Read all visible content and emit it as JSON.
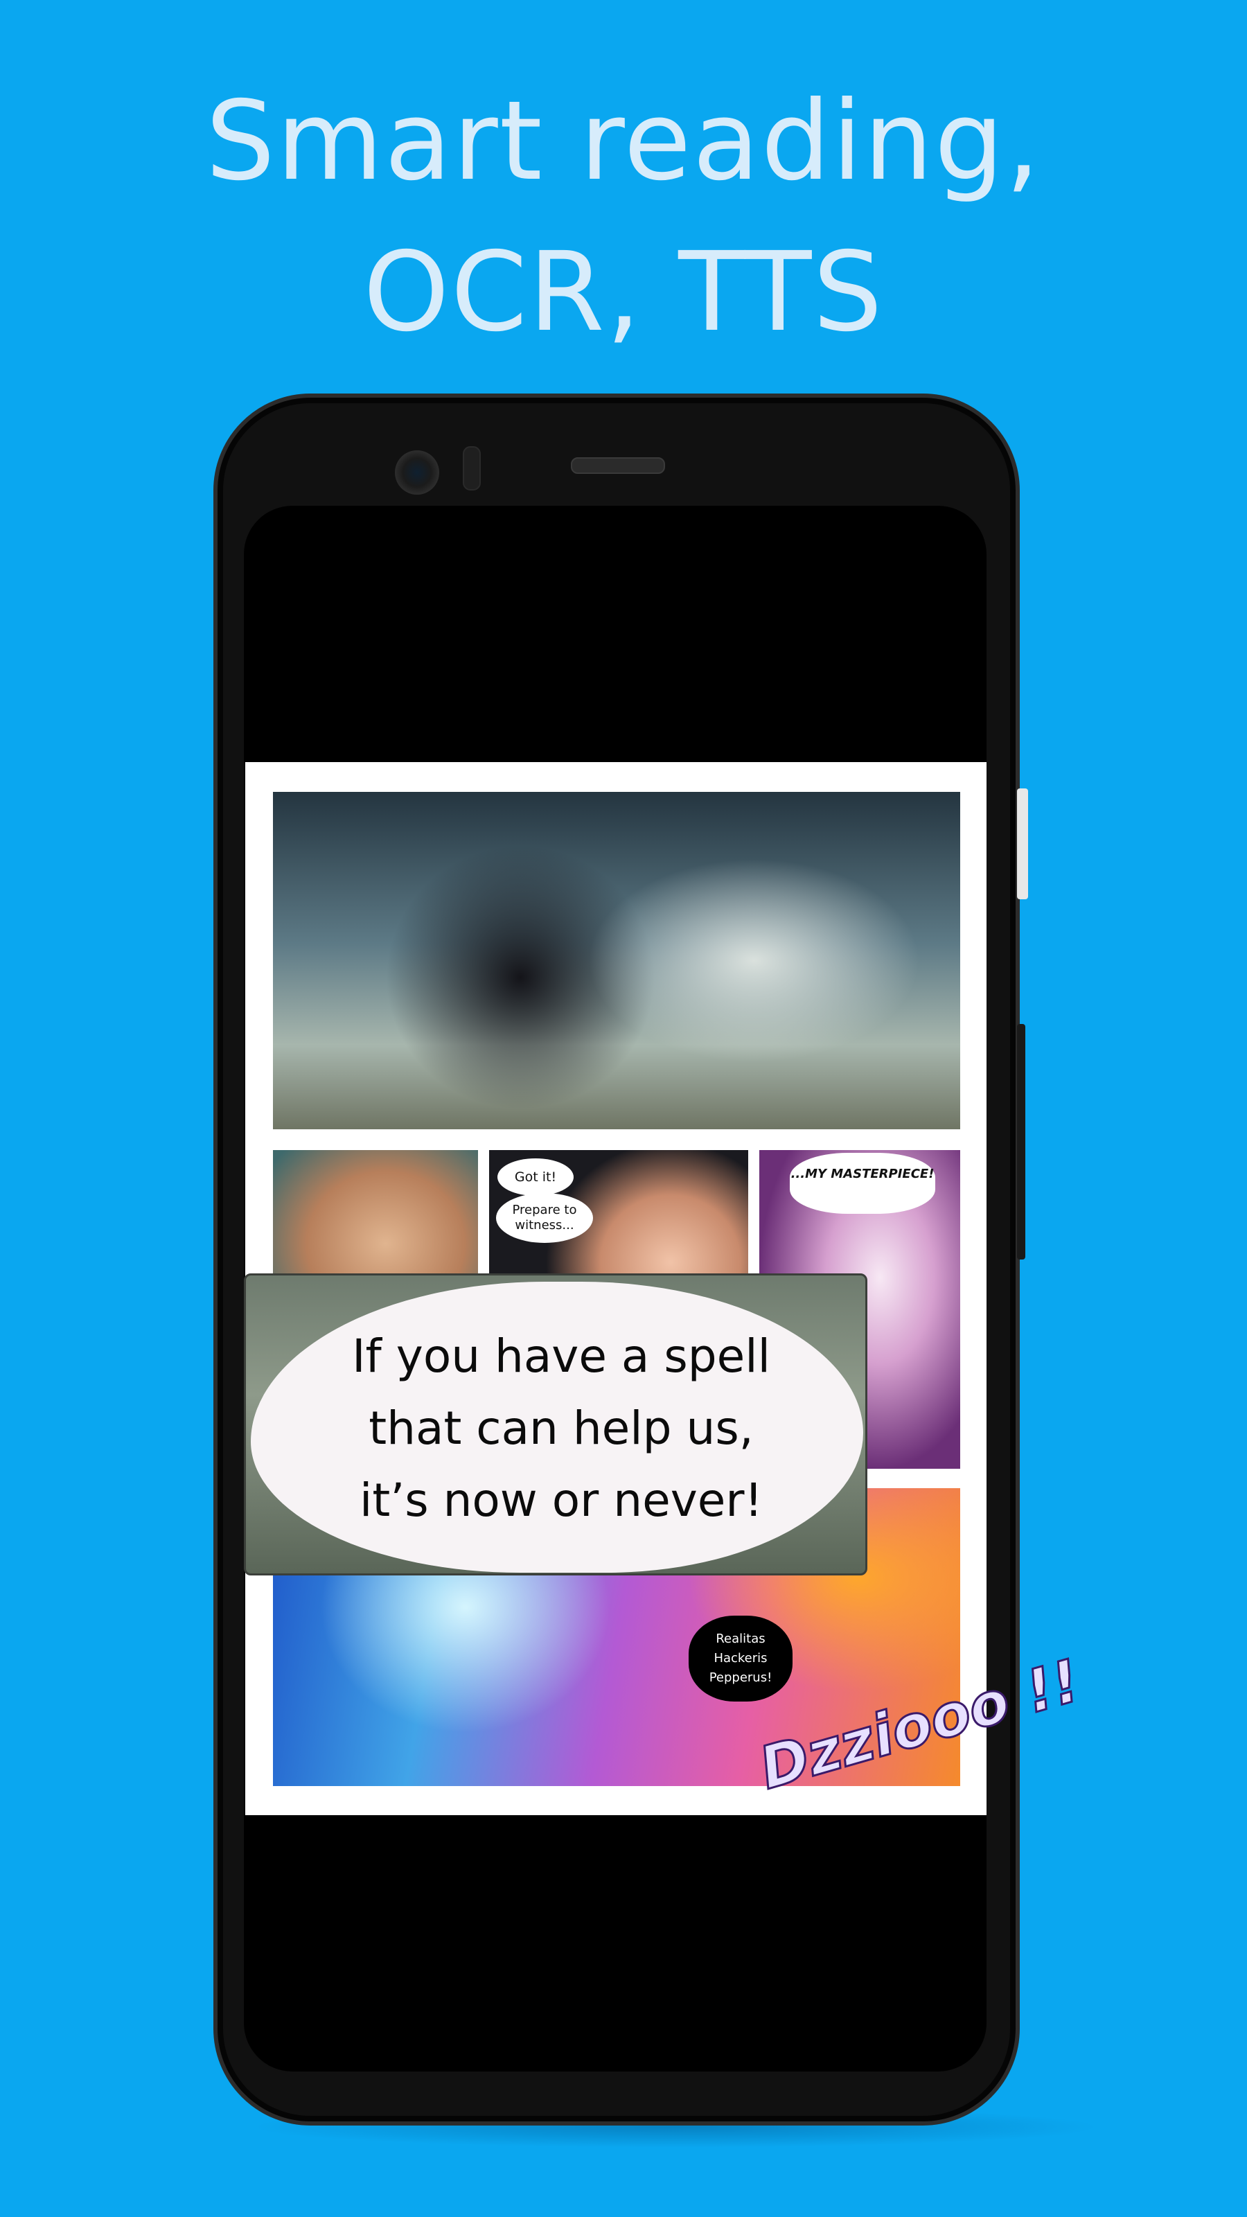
{
  "headline": {
    "line1": "Smart reading,",
    "line2": "OCR, TTS"
  },
  "colors": {
    "background": "#0aa7f0",
    "headline_text": "#d7ecfb",
    "phone_frame": "#111111",
    "page": "#ffffff"
  },
  "comic": {
    "bubble_got_it": "Got it!",
    "bubble_prepare": "Prepare to witness...",
    "bubble_masterpiece": "...MY MASTERPIECE!",
    "bubble_spell": "Realitas Hackeris Pepperus!",
    "sfx": "Dzziooo !!"
  },
  "ocr_popup": {
    "line1": "If you have a spell",
    "line2": "that can help us,",
    "line3": "it’s now or never!"
  },
  "icons": {
    "camera": "front-camera-icon",
    "speaker": "earpiece-icon"
  }
}
